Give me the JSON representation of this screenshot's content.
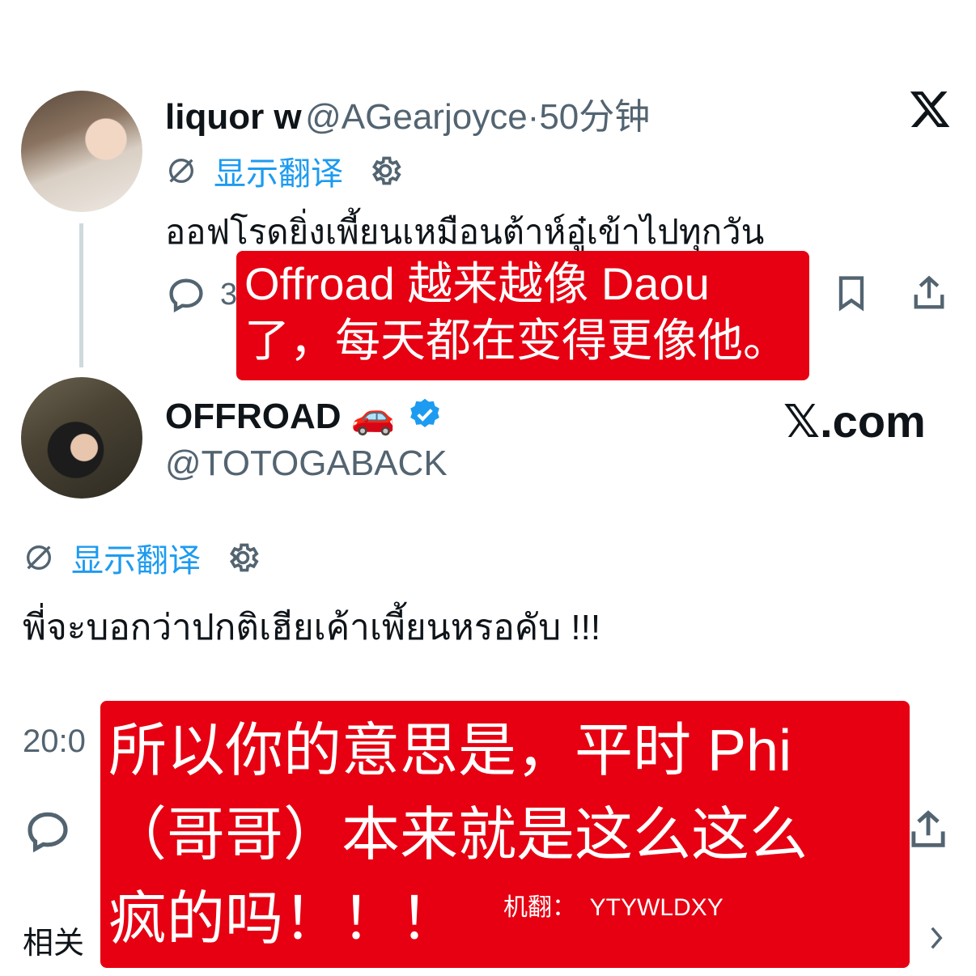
{
  "tweet1": {
    "author_name": "liquor w",
    "author_handle": "@AGearjoyce",
    "separator": "·",
    "time": "50分钟",
    "translate_label": "显示翻译",
    "text": "ออฟโรดยิ่งเพี้ยนเหมือนต้าห์อู๋เข้าไปทุกวัน",
    "reply_count": "3"
  },
  "tweet2": {
    "author_name": "OFFROAD 🚗",
    "author_handle": "@TOTOGABACK",
    "translate_label": "显示翻译",
    "text": "พี่จะบอกว่าปกติเฮียเค้าเพี้ยนหรอคับ !!!",
    "timestamp_partial": "20:0"
  },
  "footer": {
    "related_partial": "相关"
  },
  "watermark": {
    "x_logo": "𝕏",
    "site": "𝕏.com"
  },
  "overlay1": {
    "line1": "Offroad 越来越像 Daou",
    "line2": "了，每天都在变得更像他。"
  },
  "overlay2": {
    "line1": "所以你的意思是，平时 Phi",
    "line2": "（哥哥）本来就是这么这么",
    "line3": "疯的吗！！！",
    "credit": "机翻：  YTYWLDXY"
  },
  "colors": {
    "accent": "#1d9bf0",
    "muted": "#536471",
    "overlay_red": "#e60012"
  }
}
